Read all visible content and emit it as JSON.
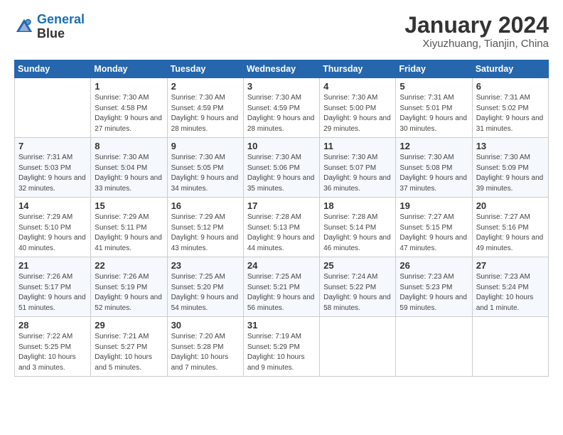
{
  "logo": {
    "line1": "General",
    "line2": "Blue"
  },
  "title": "January 2024",
  "location": "Xiyuzhuang, Tianjin, China",
  "header_days": [
    "Sunday",
    "Monday",
    "Tuesday",
    "Wednesday",
    "Thursday",
    "Friday",
    "Saturday"
  ],
  "weeks": [
    [
      {
        "day": "",
        "sunrise": "",
        "sunset": "",
        "daylight": ""
      },
      {
        "day": "1",
        "sunrise": "Sunrise: 7:30 AM",
        "sunset": "Sunset: 4:58 PM",
        "daylight": "Daylight: 9 hours and 27 minutes."
      },
      {
        "day": "2",
        "sunrise": "Sunrise: 7:30 AM",
        "sunset": "Sunset: 4:59 PM",
        "daylight": "Daylight: 9 hours and 28 minutes."
      },
      {
        "day": "3",
        "sunrise": "Sunrise: 7:30 AM",
        "sunset": "Sunset: 4:59 PM",
        "daylight": "Daylight: 9 hours and 28 minutes."
      },
      {
        "day": "4",
        "sunrise": "Sunrise: 7:30 AM",
        "sunset": "Sunset: 5:00 PM",
        "daylight": "Daylight: 9 hours and 29 minutes."
      },
      {
        "day": "5",
        "sunrise": "Sunrise: 7:31 AM",
        "sunset": "Sunset: 5:01 PM",
        "daylight": "Daylight: 9 hours and 30 minutes."
      },
      {
        "day": "6",
        "sunrise": "Sunrise: 7:31 AM",
        "sunset": "Sunset: 5:02 PM",
        "daylight": "Daylight: 9 hours and 31 minutes."
      }
    ],
    [
      {
        "day": "7",
        "sunrise": "Sunrise: 7:31 AM",
        "sunset": "Sunset: 5:03 PM",
        "daylight": "Daylight: 9 hours and 32 minutes."
      },
      {
        "day": "8",
        "sunrise": "Sunrise: 7:30 AM",
        "sunset": "Sunset: 5:04 PM",
        "daylight": "Daylight: 9 hours and 33 minutes."
      },
      {
        "day": "9",
        "sunrise": "Sunrise: 7:30 AM",
        "sunset": "Sunset: 5:05 PM",
        "daylight": "Daylight: 9 hours and 34 minutes."
      },
      {
        "day": "10",
        "sunrise": "Sunrise: 7:30 AM",
        "sunset": "Sunset: 5:06 PM",
        "daylight": "Daylight: 9 hours and 35 minutes."
      },
      {
        "day": "11",
        "sunrise": "Sunrise: 7:30 AM",
        "sunset": "Sunset: 5:07 PM",
        "daylight": "Daylight: 9 hours and 36 minutes."
      },
      {
        "day": "12",
        "sunrise": "Sunrise: 7:30 AM",
        "sunset": "Sunset: 5:08 PM",
        "daylight": "Daylight: 9 hours and 37 minutes."
      },
      {
        "day": "13",
        "sunrise": "Sunrise: 7:30 AM",
        "sunset": "Sunset: 5:09 PM",
        "daylight": "Daylight: 9 hours and 39 minutes."
      }
    ],
    [
      {
        "day": "14",
        "sunrise": "Sunrise: 7:29 AM",
        "sunset": "Sunset: 5:10 PM",
        "daylight": "Daylight: 9 hours and 40 minutes."
      },
      {
        "day": "15",
        "sunrise": "Sunrise: 7:29 AM",
        "sunset": "Sunset: 5:11 PM",
        "daylight": "Daylight: 9 hours and 41 minutes."
      },
      {
        "day": "16",
        "sunrise": "Sunrise: 7:29 AM",
        "sunset": "Sunset: 5:12 PM",
        "daylight": "Daylight: 9 hours and 43 minutes."
      },
      {
        "day": "17",
        "sunrise": "Sunrise: 7:28 AM",
        "sunset": "Sunset: 5:13 PM",
        "daylight": "Daylight: 9 hours and 44 minutes."
      },
      {
        "day": "18",
        "sunrise": "Sunrise: 7:28 AM",
        "sunset": "Sunset: 5:14 PM",
        "daylight": "Daylight: 9 hours and 46 minutes."
      },
      {
        "day": "19",
        "sunrise": "Sunrise: 7:27 AM",
        "sunset": "Sunset: 5:15 PM",
        "daylight": "Daylight: 9 hours and 47 minutes."
      },
      {
        "day": "20",
        "sunrise": "Sunrise: 7:27 AM",
        "sunset": "Sunset: 5:16 PM",
        "daylight": "Daylight: 9 hours and 49 minutes."
      }
    ],
    [
      {
        "day": "21",
        "sunrise": "Sunrise: 7:26 AM",
        "sunset": "Sunset: 5:17 PM",
        "daylight": "Daylight: 9 hours and 51 minutes."
      },
      {
        "day": "22",
        "sunrise": "Sunrise: 7:26 AM",
        "sunset": "Sunset: 5:19 PM",
        "daylight": "Daylight: 9 hours and 52 minutes."
      },
      {
        "day": "23",
        "sunrise": "Sunrise: 7:25 AM",
        "sunset": "Sunset: 5:20 PM",
        "daylight": "Daylight: 9 hours and 54 minutes."
      },
      {
        "day": "24",
        "sunrise": "Sunrise: 7:25 AM",
        "sunset": "Sunset: 5:21 PM",
        "daylight": "Daylight: 9 hours and 56 minutes."
      },
      {
        "day": "25",
        "sunrise": "Sunrise: 7:24 AM",
        "sunset": "Sunset: 5:22 PM",
        "daylight": "Daylight: 9 hours and 58 minutes."
      },
      {
        "day": "26",
        "sunrise": "Sunrise: 7:23 AM",
        "sunset": "Sunset: 5:23 PM",
        "daylight": "Daylight: 9 hours and 59 minutes."
      },
      {
        "day": "27",
        "sunrise": "Sunrise: 7:23 AM",
        "sunset": "Sunset: 5:24 PM",
        "daylight": "Daylight: 10 hours and 1 minute."
      }
    ],
    [
      {
        "day": "28",
        "sunrise": "Sunrise: 7:22 AM",
        "sunset": "Sunset: 5:25 PM",
        "daylight": "Daylight: 10 hours and 3 minutes."
      },
      {
        "day": "29",
        "sunrise": "Sunrise: 7:21 AM",
        "sunset": "Sunset: 5:27 PM",
        "daylight": "Daylight: 10 hours and 5 minutes."
      },
      {
        "day": "30",
        "sunrise": "Sunrise: 7:20 AM",
        "sunset": "Sunset: 5:28 PM",
        "daylight": "Daylight: 10 hours and 7 minutes."
      },
      {
        "day": "31",
        "sunrise": "Sunrise: 7:19 AM",
        "sunset": "Sunset: 5:29 PM",
        "daylight": "Daylight: 10 hours and 9 minutes."
      },
      {
        "day": "",
        "sunrise": "",
        "sunset": "",
        "daylight": ""
      },
      {
        "day": "",
        "sunrise": "",
        "sunset": "",
        "daylight": ""
      },
      {
        "day": "",
        "sunrise": "",
        "sunset": "",
        "daylight": ""
      }
    ]
  ]
}
